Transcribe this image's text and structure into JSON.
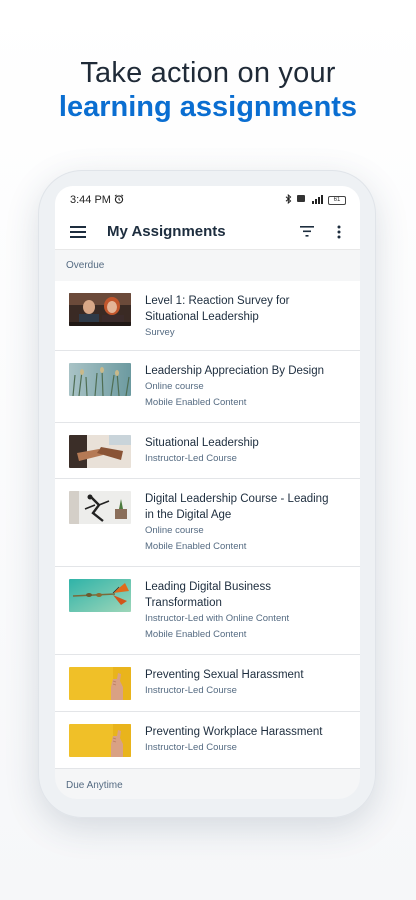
{
  "headline": {
    "line1": "Take action on your",
    "line2": "learning assignments"
  },
  "status_bar": {
    "time": "3:44 PM",
    "battery": "61"
  },
  "app_bar": {
    "title": "My Assignments"
  },
  "sections": {
    "overdue": "Overdue",
    "due_anytime": "Due Anytime"
  },
  "assignments": [
    {
      "title_l1": "Level 1: Reaction Survey for",
      "title_l2": "Situational Leadership",
      "type": "Survey",
      "extra": ""
    },
    {
      "title_l1": "Leadership Appreciation By Design",
      "title_l2": "",
      "type": "Online course",
      "extra": "Mobile Enabled Content"
    },
    {
      "title_l1": "Situational Leadership",
      "title_l2": "",
      "type": "Instructor-Led Course",
      "extra": ""
    },
    {
      "title_l1": "Digital Leadership Course - Leading",
      "title_l2": "in the Digital Age",
      "type": "Online course",
      "extra": "Mobile Enabled Content"
    },
    {
      "title_l1": "Leading Digital Business",
      "title_l2": "Transformation",
      "type": "Instructor-Led with Online Content",
      "extra": "Mobile Enabled Content"
    },
    {
      "title_l1": "Preventing Sexual Harassment",
      "title_l2": "",
      "type": "Instructor-Led Course",
      "extra": ""
    },
    {
      "title_l1": "Preventing Workplace Harassment",
      "title_l2": "",
      "type": "Instructor-Led Course",
      "extra": ""
    }
  ],
  "colors": {
    "brand_blue": "#0a6ed1",
    "text_dark": "#1d2d3e",
    "text_secondary": "#556b82"
  },
  "icons": [
    "alarm-icon",
    "bluetooth-icon",
    "signal-icon",
    "battery-icon",
    "menu-icon",
    "filter-icon",
    "more-vert-icon"
  ]
}
